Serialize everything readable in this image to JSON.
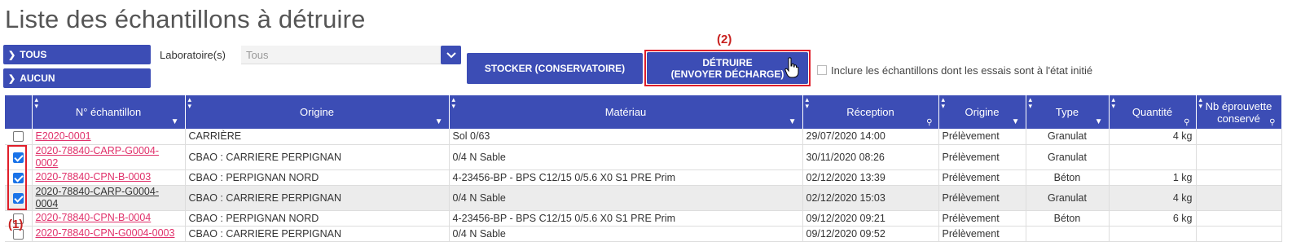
{
  "page_title": "Liste des échantillons à détruire",
  "toolbar": {
    "all_label": "TOUS",
    "none_label": "AUCUN",
    "lab_label": "Laboratoire(s)",
    "lab_value": "Tous",
    "store_label": "STOCKER (CONSERVATOIRE)",
    "destroy_line1": "DÉTRUIRE",
    "destroy_line2": "(ENVOYER DÉCHARGE)",
    "include_label": "Inclure les échantillons dont les essais sont à l'état initié"
  },
  "annotations": {
    "a1": "(1)",
    "a2": "(2)"
  },
  "table": {
    "headers": {
      "sample_no": "N° échantillon",
      "origin": "Origine",
      "material": "Matériau",
      "reception": "Réception",
      "origin2": "Origine",
      "type": "Type",
      "quantity": "Quantité",
      "nb_line1": "Nb éprouvette",
      "nb_line2": "conservé"
    },
    "rows": [
      {
        "checked": false,
        "sample": "E2020-0001",
        "origin": "CARRIÈRE",
        "material": "Sol 0/63",
        "reception": "29/07/2020 14:00",
        "origin2": "Prélèvement",
        "type": "Granulat",
        "qty": "4 kg",
        "nb": ""
      },
      {
        "checked": true,
        "sample": "2020-78840-CARP-G0004-0002",
        "origin": "CBAO : CARRIERE PERPIGNAN",
        "material": "0/4 N Sable",
        "reception": "30/11/2020 08:26",
        "origin2": "Prélèvement",
        "type": "Granulat",
        "qty": "",
        "nb": ""
      },
      {
        "checked": true,
        "sample": "2020-78840-CPN-B-0003",
        "origin": "CBAO : PERPIGNAN NORD",
        "material": "4-23456-BP - BPS C12/15 0/5.6 X0 S1 PRE Prim",
        "reception": "02/12/2020 13:39",
        "origin2": "Prélèvement",
        "type": "Béton",
        "qty": "1 kg",
        "nb": ""
      },
      {
        "checked": true,
        "sample": "2020-78840-CARP-G0004-0004",
        "origin": "CBAO : CARRIERE PERPIGNAN",
        "material": "0/4 N Sable",
        "reception": "02/12/2020 15:03",
        "origin2": "Prélèvement",
        "type": "Granulat",
        "qty": "4 kg",
        "nb": ""
      },
      {
        "checked": false,
        "sample": "2020-78840-CPN-B-0004",
        "origin": "CBAO : PERPIGNAN NORD",
        "material": "4-23456-BP - BPS C12/15 0/5.6 X0 S1 PRE Prim",
        "reception": "09/12/2020 09:21",
        "origin2": "Prélèvement",
        "type": "Béton",
        "qty": "6 kg",
        "nb": ""
      },
      {
        "checked": false,
        "sample": "2020-78840-CPN-G0004-0003",
        "origin": "CBAO : CARRIERE PERPIGNAN",
        "material": "0/4 N Sable",
        "reception": "09/12/2020 09:52",
        "origin2": "Prélèvement",
        "type": "",
        "qty": "",
        "nb": ""
      }
    ]
  },
  "colors": {
    "accent": "#3c4db5",
    "link": "#e0306a",
    "annotation": "#e01e2a"
  }
}
